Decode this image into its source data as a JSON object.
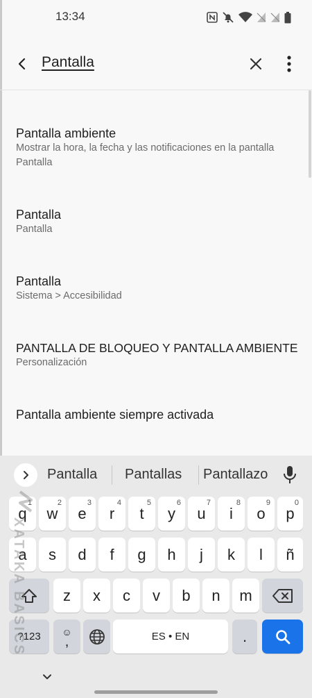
{
  "status_bar": {
    "time": "13:34",
    "icons": [
      "nfc-icon",
      "bell-off-icon",
      "wifi-icon",
      "signal-no-sim-icon",
      "signal-no-sim-icon",
      "battery-icon"
    ]
  },
  "search": {
    "query": "Pantalla",
    "back_icon": "back-arrow-icon",
    "clear_icon": "close-icon",
    "menu_icon": "more-vert-icon"
  },
  "results": [
    {
      "title": "Pantalla ambiente",
      "subtitle_lines": [
        "Mostrar la hora, la fecha y las notificaciones en la pantalla",
        "Pantalla"
      ]
    },
    {
      "title": "Pantalla",
      "subtitle_lines": [
        "Pantalla"
      ]
    },
    {
      "title": "Pantalla",
      "subtitle_lines": [
        "Sistema > Accesibilidad"
      ]
    },
    {
      "title": "PANTALLA DE BLOQUEO Y PANTALLA AMBIENTE",
      "subtitle_lines": [
        "Personalización"
      ]
    },
    {
      "title": "Pantalla ambiente siempre activada",
      "subtitle_lines": []
    }
  ],
  "keyboard": {
    "suggestions": [
      "Pantalla",
      "Pantallas",
      "Pantallazo"
    ],
    "row1": [
      {
        "key": "q",
        "hint": "1"
      },
      {
        "key": "w",
        "hint": "2"
      },
      {
        "key": "e",
        "hint": "3"
      },
      {
        "key": "r",
        "hint": "4"
      },
      {
        "key": "t",
        "hint": "5"
      },
      {
        "key": "y",
        "hint": "6"
      },
      {
        "key": "u",
        "hint": "7"
      },
      {
        "key": "i",
        "hint": "8"
      },
      {
        "key": "o",
        "hint": "9"
      },
      {
        "key": "p",
        "hint": "0"
      }
    ],
    "row2": [
      "a",
      "s",
      "d",
      "f",
      "g",
      "h",
      "j",
      "k",
      "l",
      "ñ"
    ],
    "row3": [
      "z",
      "x",
      "c",
      "v",
      "b",
      "n",
      "m"
    ],
    "symbols_key": "?123",
    "emoji_key_top": "☺",
    "emoji_key_bottom": ",",
    "space_label": "ES • EN",
    "period_key": ".",
    "accent_color": "#1a73e8"
  },
  "watermark": "XATAKA BASICS"
}
